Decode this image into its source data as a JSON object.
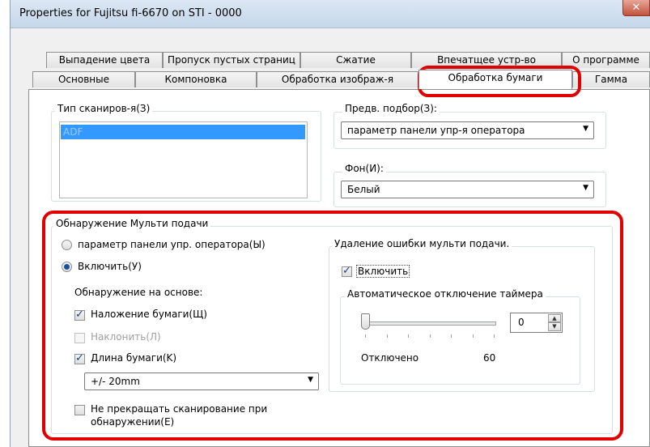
{
  "window": {
    "title": "Properties for Fujitsu fi-6670 on STI - 0000",
    "close_glyph": "✕"
  },
  "tabs_row1": [
    "Выпадение цвета",
    "Пропуск пустых страниц",
    "Сжатие",
    "Впечатщее устр-во",
    "О программе"
  ],
  "tabs_row2": [
    "Основные",
    "Компоновка",
    "Обработка изображ-я",
    "Обработка бумаги",
    "Гамма"
  ],
  "active_tab": "Обработка бумаги",
  "scan_type": {
    "label": "Тип сканиров-я(З)",
    "items": [
      "ADF"
    ]
  },
  "preset": {
    "label": "Предв. подбор(З):",
    "value": "параметр панели упр-я оператора"
  },
  "background": {
    "label": "Фон(И):",
    "value": "Белый"
  },
  "multifeed": {
    "label": "Обнаружение Мульти подачи",
    "radio_operator_label": "параметр панели упр. оператора(Ы)",
    "radio_enable_label": "Включить(У)",
    "detection_basis_label": "Обнаружение на основе:",
    "overlap_label": "Наложение бумаги(Щ)",
    "skew_label": "Наклонить(Л)",
    "length_label": "Длина бумаги(K)",
    "length_value": "+/- 20mm",
    "no_stop_label_line1": "Не прекращать сканирование при",
    "no_stop_label_line2": "обнаружении(Е)",
    "radio_operator_checked": false,
    "radio_enable_checked": true,
    "overlap_checked": true,
    "skew_checked": false,
    "length_checked": true,
    "no_stop_checked": false
  },
  "error_removal": {
    "label": "Удаление ошибки мульти подачи.",
    "enable_label": "Включить",
    "enable_checked": true,
    "timer_label": "Автоматическое отключение таймера",
    "timer_value": "0",
    "slider_min_label": "Отключено",
    "slider_max_label": "60",
    "slider_value": 0
  },
  "colors": {
    "highlight": "#e00000",
    "selection": "#3399ff"
  }
}
